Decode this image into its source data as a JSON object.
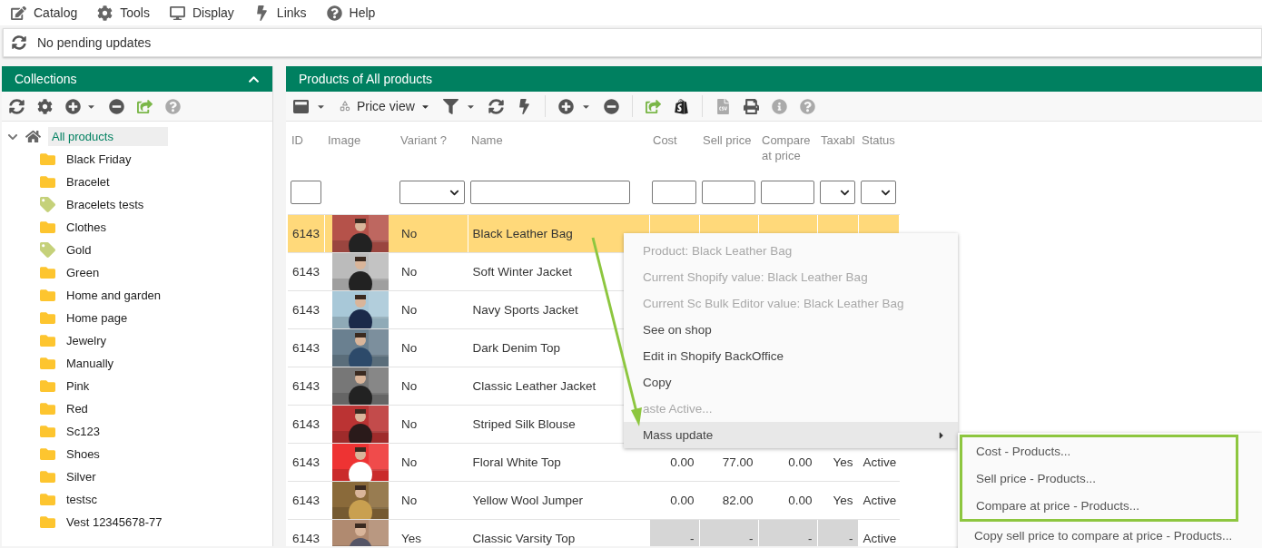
{
  "menu_bar": [
    {
      "label": "Catalog",
      "kind": "edit"
    },
    {
      "label": "Tools",
      "kind": "gear"
    },
    {
      "label": "Display",
      "kind": "monitor"
    },
    {
      "label": "Links",
      "kind": "bolt"
    },
    {
      "label": "Help",
      "kind": "help"
    }
  ],
  "status_bar": {
    "text": "No pending updates"
  },
  "collections": {
    "title": "Collections",
    "expanded": true,
    "tree": [
      {
        "label": "All products",
        "kind": "home",
        "selected": true,
        "expanded": true,
        "children": [
          {
            "label": "Black Friday",
            "kind": "folder",
            "selected": false
          },
          {
            "label": "Bracelet",
            "kind": "folder",
            "selected": false
          },
          {
            "label": "Bracelets tests",
            "kind": "tag",
            "selected": false
          },
          {
            "label": "Clothes",
            "kind": "folder",
            "selected": false
          },
          {
            "label": "Gold",
            "kind": "tag",
            "selected": false
          },
          {
            "label": "Green",
            "kind": "folder",
            "selected": false
          },
          {
            "label": "Home and garden",
            "kind": "folder",
            "selected": false
          },
          {
            "label": "Home page",
            "kind": "folder",
            "selected": false
          },
          {
            "label": "Jewelry",
            "kind": "folder",
            "selected": false
          },
          {
            "label": "Manually",
            "kind": "folder",
            "selected": false
          },
          {
            "label": "Pink",
            "kind": "folder",
            "selected": false
          },
          {
            "label": "Red",
            "kind": "folder",
            "selected": false
          },
          {
            "label": "Sc123",
            "kind": "folder",
            "selected": false
          },
          {
            "label": "Shoes",
            "kind": "folder",
            "selected": false
          },
          {
            "label": "Silver",
            "kind": "folder",
            "selected": false
          },
          {
            "label": "testsc",
            "kind": "folder",
            "selected": false
          },
          {
            "label": "Vest 12345678-77",
            "kind": "folder",
            "selected": false
          }
        ]
      }
    ]
  },
  "products": {
    "title": "Products of All products",
    "view": "Price view",
    "columns": [
      {
        "label": "ID",
        "kind": "text"
      },
      {
        "label": "Image",
        "kind": "none"
      },
      {
        "label": "Variant ?",
        "kind": "select"
      },
      {
        "label": "Name",
        "kind": "text"
      },
      {
        "label": "Cost",
        "kind": "text"
      },
      {
        "label": "Sell price",
        "kind": "text"
      },
      {
        "label": "Compare at price",
        "kind": "text"
      },
      {
        "label": "Taxabl",
        "kind": "select"
      },
      {
        "label": "Status",
        "kind": "select"
      }
    ],
    "rows": [
      {
        "id": "6143",
        "variant": "No",
        "name": "Black Leather Bag",
        "selected": true,
        "kind": "product"
      },
      {
        "id": "6143",
        "variant": "No",
        "name": "Soft Winter Jacket",
        "selected": false,
        "kind": "product"
      },
      {
        "id": "6143",
        "variant": "No",
        "name": "Navy Sports Jacket",
        "selected": false,
        "kind": "product"
      },
      {
        "id": "6143",
        "variant": "No",
        "name": "Dark Denim Top",
        "selected": false,
        "kind": "product"
      },
      {
        "id": "6143",
        "variant": "No",
        "name": "Classic Leather Jacket",
        "selected": false,
        "kind": "product"
      },
      {
        "id": "6143",
        "variant": "No",
        "name": "Striped Silk Blouse",
        "selected": false,
        "kind": "product"
      },
      {
        "id": "6143",
        "variant": "No",
        "name": "Floral White Top",
        "cost": "0.00",
        "sell": "77.00",
        "compare": "0.00",
        "taxable": "Yes",
        "status": "Active",
        "selected": false,
        "kind": "product"
      },
      {
        "id": "6143",
        "variant": "No",
        "name": "Yellow Wool Jumper",
        "cost": "0.00",
        "sell": "82.00",
        "compare": "0.00",
        "taxable": "Yes",
        "status": "Active",
        "selected": false,
        "kind": "product"
      },
      {
        "id": "6143",
        "variant": "Yes",
        "name": "Classic Varsity Top",
        "cost": "-",
        "sell": "-",
        "compare": "-",
        "taxable": "-",
        "status": "Active",
        "selected": false,
        "kind": "parent"
      }
    ]
  },
  "context_menu": {
    "items": [
      {
        "label": "Product: Black Leather Bag",
        "disabled": true,
        "selected": false
      },
      {
        "label": "Current Shopify value: Black Leather Bag",
        "disabled": true,
        "selected": false
      },
      {
        "label": "Current Sc Bulk Editor value: Black Leather Bag",
        "disabled": true,
        "selected": false
      },
      {
        "label": "See on shop",
        "disabled": false,
        "selected": false
      },
      {
        "label": "Edit in Shopify BackOffice",
        "disabled": false,
        "selected": false
      },
      {
        "label": "Copy",
        "disabled": false,
        "selected": false
      },
      {
        "label": "aste Active...",
        "disabled": true,
        "selected": false
      },
      {
        "label": "Mass update",
        "disabled": false,
        "selected": true,
        "submenu": true
      }
    ],
    "submenu": [
      {
        "label": "Cost - Products...",
        "annotated": true
      },
      {
        "label": "Sell price - Products...",
        "annotated": true
      },
      {
        "label": "Compare at price - Products...",
        "annotated": true
      },
      {
        "label": "Copy sell price to compare at price - Products...",
        "annotated": false
      }
    ]
  }
}
